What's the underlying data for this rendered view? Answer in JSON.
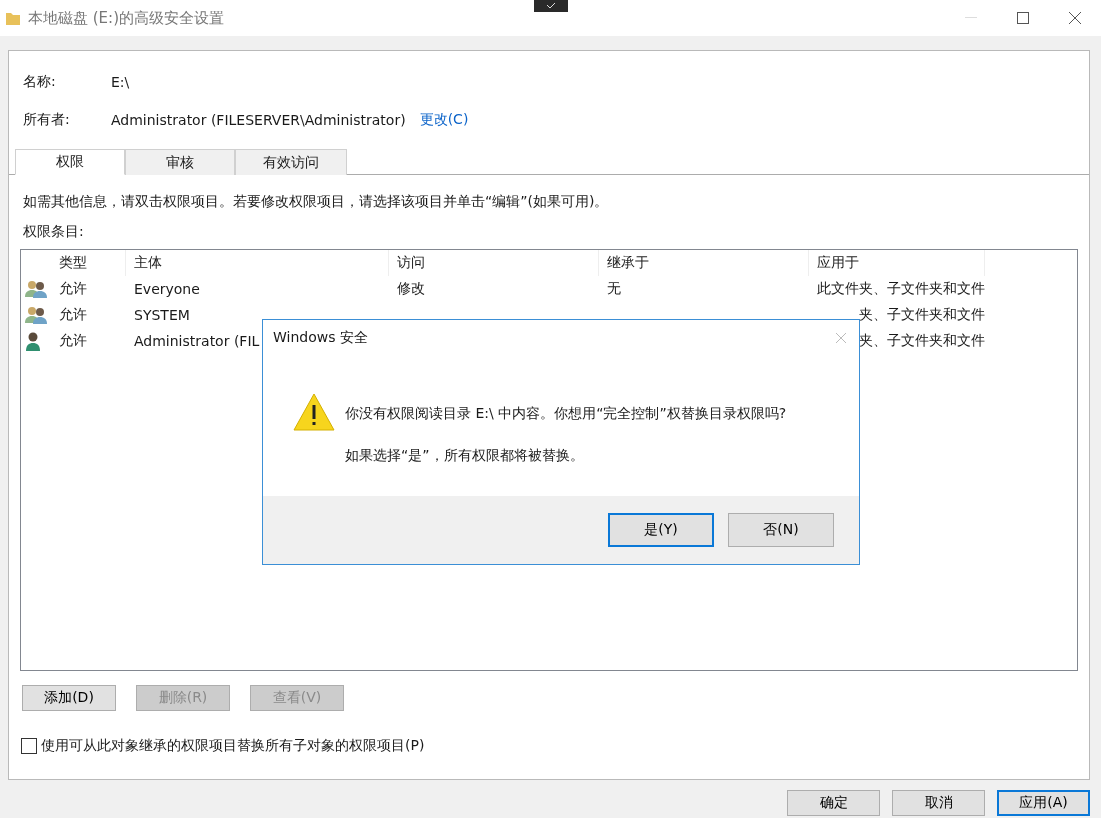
{
  "window": {
    "title": "本地磁盘 (E:)的高级安全设置"
  },
  "name": {
    "label": "名称:",
    "value": "E:\\"
  },
  "owner": {
    "label": "所有者:",
    "value": "Administrator (FILESERVER\\Administrator)",
    "link": "更改(C)"
  },
  "tabs": [
    {
      "label": "权限",
      "selected": true
    },
    {
      "label": "审核",
      "selected": false
    },
    {
      "label": "有效访问",
      "selected": false
    }
  ],
  "info_text": "如需其他信息，请双击权限项目。若要修改权限项目，请选择该项目并单击“编辑”(如果可用)。",
  "entries_label": "权限条目:",
  "table": {
    "columns": [
      "类型",
      "主体",
      "访问",
      "继承于",
      "应用于"
    ],
    "rows": [
      {
        "kind": "group",
        "type": "允许",
        "principal": "Everyone",
        "access": "修改",
        "inherited_from": "无",
        "applies_to": "此文件夹、子文件夹和文件"
      },
      {
        "kind": "group",
        "type": "允许",
        "principal": "SYSTEM",
        "applies_to": "夹、子文件夹和文件"
      },
      {
        "kind": "user",
        "type": "允许",
        "principal": "Administrator (FIL",
        "applies_to": "夹、子文件夹和文件"
      }
    ]
  },
  "buttons": [
    {
      "label": "添加(D)",
      "disabled": false
    },
    {
      "label": "删除(R)",
      "disabled": true
    },
    {
      "label": "查看(V)",
      "disabled": true
    }
  ],
  "checkbox": {
    "label": "使用可从此对象继承的权限项目替换所有子对象的权限项目(P)",
    "checked": false
  },
  "footer_buttons": [
    {
      "label": "确定",
      "default": false
    },
    {
      "label": "取消",
      "default": false
    },
    {
      "label": "应用(A)",
      "default": true
    }
  ],
  "dialog": {
    "title": "Windows 安全",
    "message": "你没有权限阅读目录 E:\\ 中内容。你想用“完全控制”权替换目录权限吗?",
    "note": "如果选择“是”，所有权限都将被替换。",
    "buttons": [
      {
        "label": "是(Y)",
        "default": true
      },
      {
        "label": "否(N)",
        "default": false
      }
    ]
  }
}
